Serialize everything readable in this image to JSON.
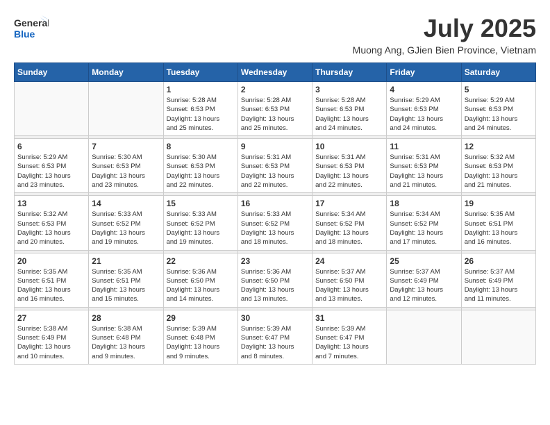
{
  "header": {
    "logo_general": "General",
    "logo_blue": "Blue",
    "month_title": "July 2025",
    "subtitle": "Muong Ang, GJien Bien Province, Vietnam"
  },
  "days_of_week": [
    "Sunday",
    "Monday",
    "Tuesday",
    "Wednesday",
    "Thursday",
    "Friday",
    "Saturday"
  ],
  "weeks": [
    [
      {
        "day": "",
        "info": ""
      },
      {
        "day": "",
        "info": ""
      },
      {
        "day": "1",
        "info": "Sunrise: 5:28 AM\nSunset: 6:53 PM\nDaylight: 13 hours\nand 25 minutes."
      },
      {
        "day": "2",
        "info": "Sunrise: 5:28 AM\nSunset: 6:53 PM\nDaylight: 13 hours\nand 25 minutes."
      },
      {
        "day": "3",
        "info": "Sunrise: 5:28 AM\nSunset: 6:53 PM\nDaylight: 13 hours\nand 24 minutes."
      },
      {
        "day": "4",
        "info": "Sunrise: 5:29 AM\nSunset: 6:53 PM\nDaylight: 13 hours\nand 24 minutes."
      },
      {
        "day": "5",
        "info": "Sunrise: 5:29 AM\nSunset: 6:53 PM\nDaylight: 13 hours\nand 24 minutes."
      }
    ],
    [
      {
        "day": "6",
        "info": "Sunrise: 5:29 AM\nSunset: 6:53 PM\nDaylight: 13 hours\nand 23 minutes."
      },
      {
        "day": "7",
        "info": "Sunrise: 5:30 AM\nSunset: 6:53 PM\nDaylight: 13 hours\nand 23 minutes."
      },
      {
        "day": "8",
        "info": "Sunrise: 5:30 AM\nSunset: 6:53 PM\nDaylight: 13 hours\nand 22 minutes."
      },
      {
        "day": "9",
        "info": "Sunrise: 5:31 AM\nSunset: 6:53 PM\nDaylight: 13 hours\nand 22 minutes."
      },
      {
        "day": "10",
        "info": "Sunrise: 5:31 AM\nSunset: 6:53 PM\nDaylight: 13 hours\nand 22 minutes."
      },
      {
        "day": "11",
        "info": "Sunrise: 5:31 AM\nSunset: 6:53 PM\nDaylight: 13 hours\nand 21 minutes."
      },
      {
        "day": "12",
        "info": "Sunrise: 5:32 AM\nSunset: 6:53 PM\nDaylight: 13 hours\nand 21 minutes."
      }
    ],
    [
      {
        "day": "13",
        "info": "Sunrise: 5:32 AM\nSunset: 6:53 PM\nDaylight: 13 hours\nand 20 minutes."
      },
      {
        "day": "14",
        "info": "Sunrise: 5:33 AM\nSunset: 6:52 PM\nDaylight: 13 hours\nand 19 minutes."
      },
      {
        "day": "15",
        "info": "Sunrise: 5:33 AM\nSunset: 6:52 PM\nDaylight: 13 hours\nand 19 minutes."
      },
      {
        "day": "16",
        "info": "Sunrise: 5:33 AM\nSunset: 6:52 PM\nDaylight: 13 hours\nand 18 minutes."
      },
      {
        "day": "17",
        "info": "Sunrise: 5:34 AM\nSunset: 6:52 PM\nDaylight: 13 hours\nand 18 minutes."
      },
      {
        "day": "18",
        "info": "Sunrise: 5:34 AM\nSunset: 6:52 PM\nDaylight: 13 hours\nand 17 minutes."
      },
      {
        "day": "19",
        "info": "Sunrise: 5:35 AM\nSunset: 6:51 PM\nDaylight: 13 hours\nand 16 minutes."
      }
    ],
    [
      {
        "day": "20",
        "info": "Sunrise: 5:35 AM\nSunset: 6:51 PM\nDaylight: 13 hours\nand 16 minutes."
      },
      {
        "day": "21",
        "info": "Sunrise: 5:35 AM\nSunset: 6:51 PM\nDaylight: 13 hours\nand 15 minutes."
      },
      {
        "day": "22",
        "info": "Sunrise: 5:36 AM\nSunset: 6:50 PM\nDaylight: 13 hours\nand 14 minutes."
      },
      {
        "day": "23",
        "info": "Sunrise: 5:36 AM\nSunset: 6:50 PM\nDaylight: 13 hours\nand 13 minutes."
      },
      {
        "day": "24",
        "info": "Sunrise: 5:37 AM\nSunset: 6:50 PM\nDaylight: 13 hours\nand 13 minutes."
      },
      {
        "day": "25",
        "info": "Sunrise: 5:37 AM\nSunset: 6:49 PM\nDaylight: 13 hours\nand 12 minutes."
      },
      {
        "day": "26",
        "info": "Sunrise: 5:37 AM\nSunset: 6:49 PM\nDaylight: 13 hours\nand 11 minutes."
      }
    ],
    [
      {
        "day": "27",
        "info": "Sunrise: 5:38 AM\nSunset: 6:49 PM\nDaylight: 13 hours\nand 10 minutes."
      },
      {
        "day": "28",
        "info": "Sunrise: 5:38 AM\nSunset: 6:48 PM\nDaylight: 13 hours\nand 9 minutes."
      },
      {
        "day": "29",
        "info": "Sunrise: 5:39 AM\nSunset: 6:48 PM\nDaylight: 13 hours\nand 9 minutes."
      },
      {
        "day": "30",
        "info": "Sunrise: 5:39 AM\nSunset: 6:47 PM\nDaylight: 13 hours\nand 8 minutes."
      },
      {
        "day": "31",
        "info": "Sunrise: 5:39 AM\nSunset: 6:47 PM\nDaylight: 13 hours\nand 7 minutes."
      },
      {
        "day": "",
        "info": ""
      },
      {
        "day": "",
        "info": ""
      }
    ]
  ]
}
